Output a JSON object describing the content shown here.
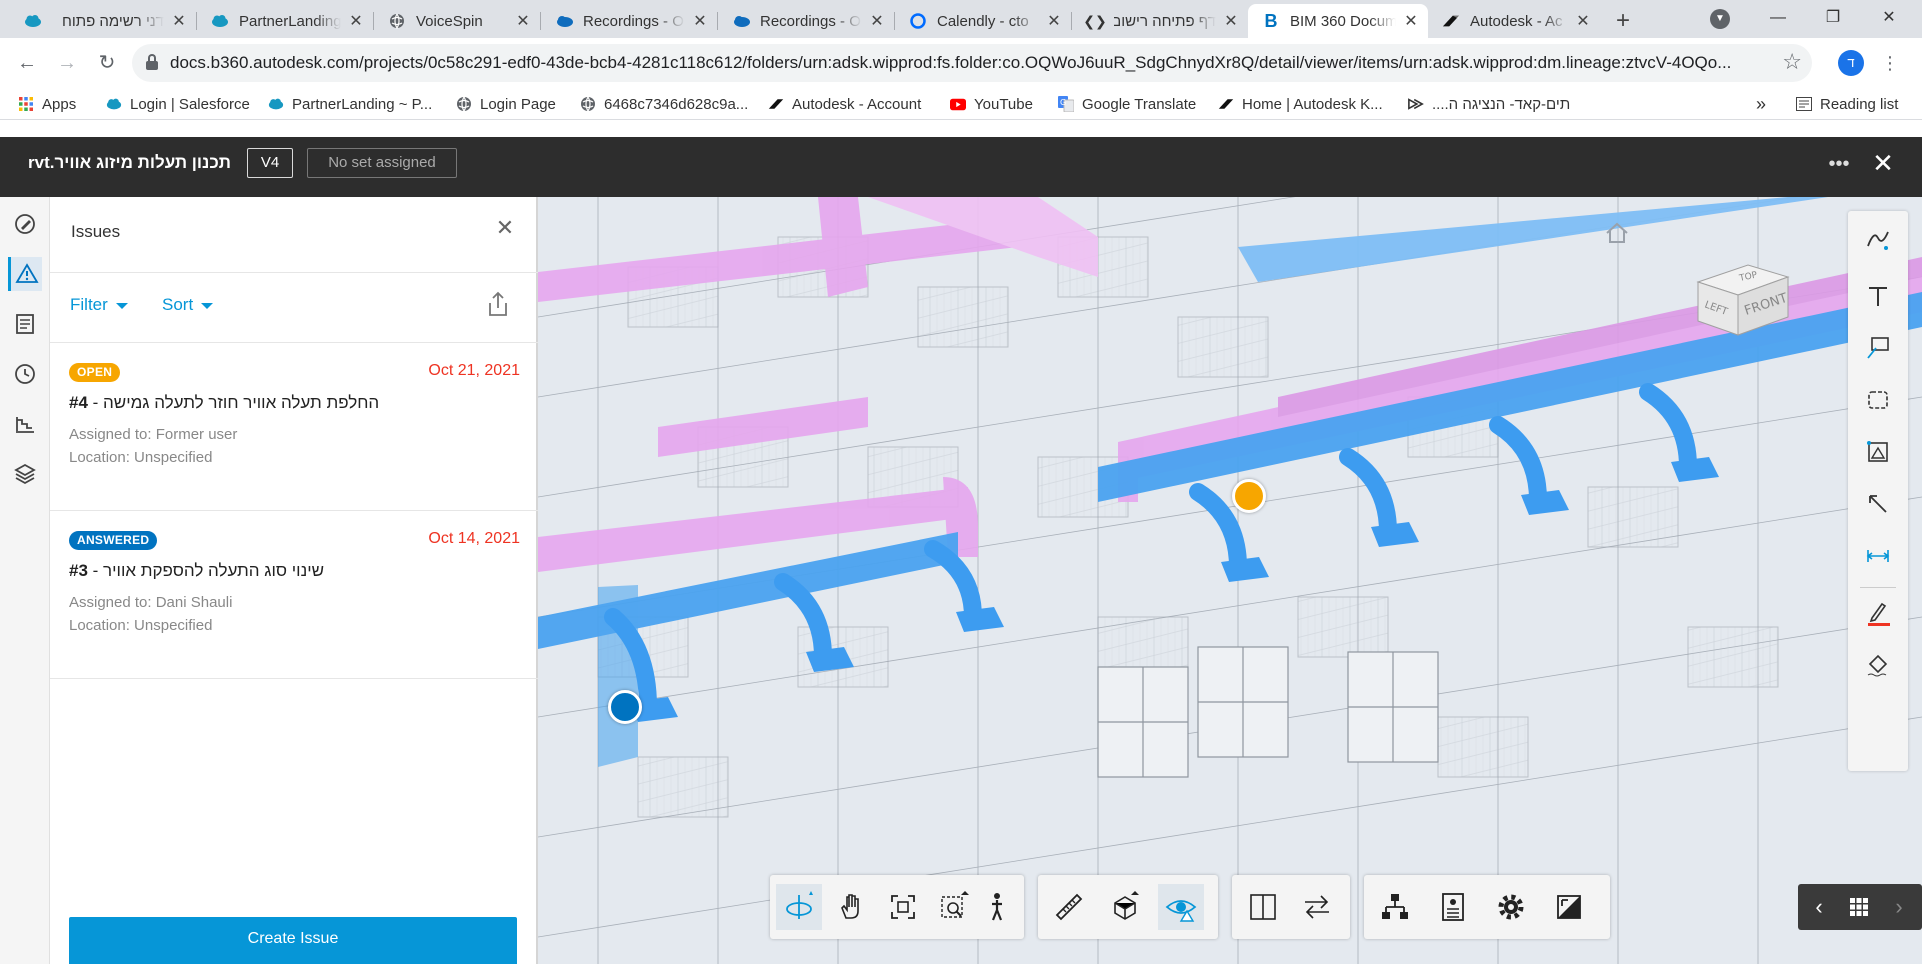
{
  "browser": {
    "tabs": [
      {
        "title": "דני רשימה פתוח",
        "active": false
      },
      {
        "title": "PartnerLanding",
        "active": false
      },
      {
        "title": "VoiceSpin",
        "active": false
      },
      {
        "title": "Recordings - O",
        "active": false
      },
      {
        "title": "Recordings - O",
        "active": false
      },
      {
        "title": "Calendly - cto",
        "active": false
      },
      {
        "title": "דף פתיחה רישום",
        "active": false
      },
      {
        "title": "BIM 360 Docum",
        "active": true
      },
      {
        "title": "Autodesk - Ac",
        "active": false
      }
    ],
    "url": "docs.b360.autodesk.com/projects/0c58c291-edf0-43de-bcb4-4281c118c612/folders/urn:adsk.wipprod:fs.folder:co.OQWoJ6uuR_SdgChnydXr8Q/detail/viewer/items/urn:adsk.wipprod:dm.lineage:ztvcV-4OQo...",
    "profile_initial": "ד",
    "bookmarks": [
      "Apps",
      "Login | Salesforce",
      "PartnerLanding ~ P...",
      "Login Page",
      "6468c7346d628c9a...",
      "Autodesk - Account",
      "YouTube",
      "Google Translate",
      "Home | Autodesk K...",
      "תים-קאד- הנציגה ה...."
    ],
    "bookmarks_more": "»",
    "reading_list": "Reading list"
  },
  "app": {
    "filename": "תכנון תעלות מיזוג אוויר.rvt",
    "version": "V4",
    "set_label": "No set assigned"
  },
  "issues_panel": {
    "title": "Issues",
    "filter_label": "Filter",
    "sort_label": "Sort",
    "create_label": "Create Issue",
    "issues": [
      {
        "status": "OPEN",
        "status_color": "#f7a600",
        "date": "Oct 21, 2021",
        "number": "#4",
        "title": " - החלפת תעלה אוויר חוזר לתעלה גמישה",
        "assigned": "Assigned to: Former user",
        "location": "Location: Unspecified"
      },
      {
        "status": "ANSWERED",
        "status_color": "#0073c0",
        "date": "Oct 14, 2021",
        "number": "#3",
        "title": " - שינוי סוג התעלה להספקת אוויר",
        "assigned": "Assigned to: Dani Shauli",
        "location": "Location: Unspecified"
      }
    ]
  },
  "viewer": {
    "viewcube_faces": [
      "TOP",
      "LEFT",
      "FRONT"
    ],
    "pins": [
      {
        "status": "OPEN",
        "color": "#f7a600"
      },
      {
        "status": "ANSWERED",
        "color": "#0073c0"
      }
    ],
    "colors": {
      "supply_duct": "#4aa3f0",
      "return_duct": "#e6a6ee",
      "accent": "#0696d7",
      "header_bg": "#2d2d2d"
    }
  }
}
